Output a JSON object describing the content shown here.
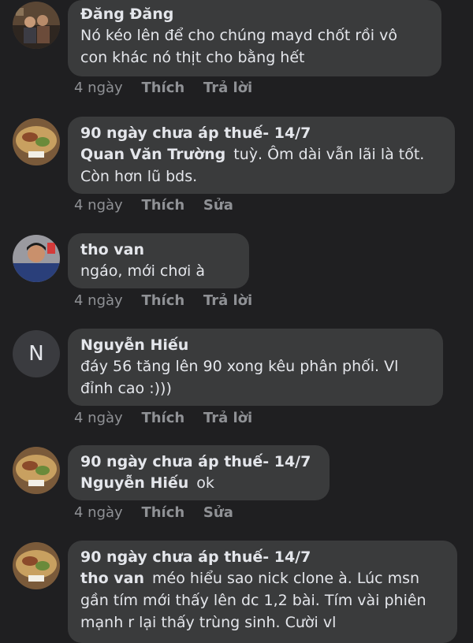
{
  "comments": [
    {
      "author": "Đăng Đăng",
      "text": "Nó kéo lên để cho chúng mayd chốt rồi vô con khác nó thịt cho bằng hết",
      "time": "4 ngày",
      "like": "Thích",
      "action": "Trả lời"
    },
    {
      "author": "90 ngày chưa áp thuế- 14/7",
      "mention": "Quan Văn Trường",
      "text": "tuỳ. Ôm dài vẫn lãi là tốt. Còn hơn lũ bds.",
      "time": "4 ngày",
      "like": "Thích",
      "action": "Sửa"
    },
    {
      "author": "tho van",
      "text": "ngáo, mới chơi à",
      "time": "4 ngày",
      "like": "Thích",
      "action": "Trả lời"
    },
    {
      "author": "Nguyễn Hiếu",
      "avatar_letter": "N",
      "text": "đáy 56 tăng lên 90 xong kêu phân phối. Vl đỉnh cao :)))",
      "time": "4 ngày",
      "like": "Thích",
      "action": "Trả lời"
    },
    {
      "author": "90 ngày chưa áp thuế- 14/7",
      "mention": "Nguyễn Hiếu",
      "text": "ok",
      "time": "4 ngày",
      "like": "Thích",
      "action": "Sửa"
    },
    {
      "author": "90 ngày chưa áp thuế- 14/7",
      "mention": "tho van",
      "text": "méo hiểu sao nick clone à. Lúc msn gần tím mới thấy lên dc 1,2 bài. Tím vài phiên mạnh r lại thấy trùng sinh. Cười vl"
    }
  ],
  "colors": {
    "background": "#1f1f21",
    "bubble": "#3a3b3c",
    "text": "#e4e6eb",
    "meta": "#8f9195"
  }
}
